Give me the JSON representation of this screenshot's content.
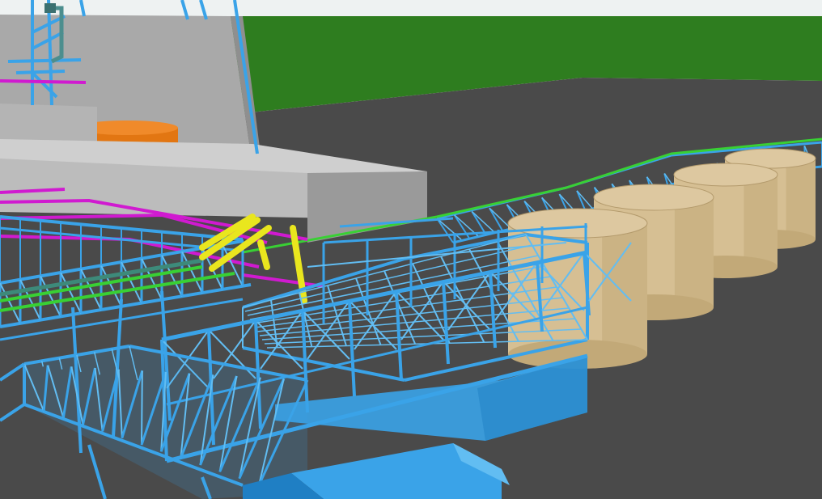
{
  "scene": {
    "description_visible_text": [],
    "colors": {
      "sky": "#eef2f2",
      "grass": "#2e7d1f",
      "ground": "#4a4a4a",
      "building_gray": "#a9a9a9",
      "building_gray_dark": "#8f8f8f",
      "building_gray_light": "#c7c7c7",
      "structure_blue": "#3aa3e8",
      "structure_blue_dark": "#1f7fc4",
      "structure_blue_light": "#62bdf2",
      "pipe_magenta": "#d01ad0",
      "pipe_green": "#39d034",
      "pipe_yellow": "#e9e61e",
      "tank_orange": "#e27612",
      "silo_tan": "#d6bf93",
      "silo_tan_dark": "#c2a978",
      "silo_tan_top": "#ddc8a0"
    },
    "silo_count": 4
  }
}
